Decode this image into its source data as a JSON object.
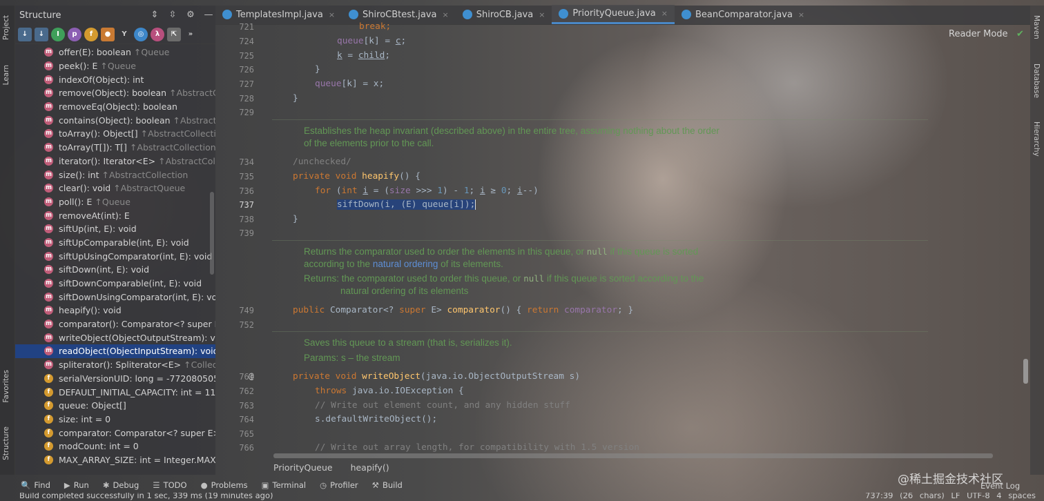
{
  "structure_panel": {
    "title": "Structure",
    "items": [
      {
        "label": "offer(E): boolean",
        "origin": "↑Queue",
        "kind": "method"
      },
      {
        "label": "peek(): E",
        "origin": "↑Queue",
        "kind": "method"
      },
      {
        "label": "indexOf(Object): int",
        "origin": "",
        "kind": "method"
      },
      {
        "label": "remove(Object): boolean",
        "origin": "↑AbstractCo",
        "kind": "method"
      },
      {
        "label": "removeEq(Object): boolean",
        "origin": "",
        "kind": "method"
      },
      {
        "label": "contains(Object): boolean",
        "origin": "↑AbstractC",
        "kind": "method"
      },
      {
        "label": "toArray(): Object[]",
        "origin": "↑AbstractCollection",
        "kind": "method"
      },
      {
        "label": "toArray(T[]): T[]",
        "origin": "↑AbstractCollection",
        "kind": "method"
      },
      {
        "label": "iterator(): Iterator<E>",
        "origin": "↑AbstractColle",
        "kind": "method"
      },
      {
        "label": "size(): int",
        "origin": "↑AbstractCollection",
        "kind": "method"
      },
      {
        "label": "clear(): void",
        "origin": "↑AbstractQueue",
        "kind": "method"
      },
      {
        "label": "poll(): E",
        "origin": "↑Queue",
        "kind": "method"
      },
      {
        "label": "removeAt(int): E",
        "origin": "",
        "kind": "method"
      },
      {
        "label": "siftUp(int, E): void",
        "origin": "",
        "kind": "method"
      },
      {
        "label": "siftUpComparable(int, E): void",
        "origin": "",
        "kind": "method"
      },
      {
        "label": "siftUpUsingComparator(int, E): void",
        "origin": "",
        "kind": "method"
      },
      {
        "label": "siftDown(int, E): void",
        "origin": "",
        "kind": "method"
      },
      {
        "label": "siftDownComparable(int, E): void",
        "origin": "",
        "kind": "method"
      },
      {
        "label": "siftDownUsingComparator(int, E): void",
        "origin": "",
        "kind": "method"
      },
      {
        "label": "heapify(): void",
        "origin": "",
        "kind": "method"
      },
      {
        "label": "comparator(): Comparator<? super E>",
        "origin": "",
        "kind": "method"
      },
      {
        "label": "writeObject(ObjectOutputStream): vo",
        "origin": "",
        "kind": "method"
      },
      {
        "label": "readObject(ObjectInputStream): void",
        "origin": "",
        "kind": "method"
      },
      {
        "label": "spliterator(): Spliterator<E>",
        "origin": "↑Collec",
        "kind": "method"
      },
      {
        "label": "serialVersionUID: long = -7720805057",
        "origin": "",
        "kind": "field"
      },
      {
        "label": "DEFAULT_INITIAL_CAPACITY: int = 11",
        "origin": "",
        "kind": "field"
      },
      {
        "label": "queue: Object[]",
        "origin": "",
        "kind": "field"
      },
      {
        "label": "size: int = 0",
        "origin": "",
        "kind": "field"
      },
      {
        "label": "comparator: Comparator<? super E>",
        "origin": "",
        "kind": "field"
      },
      {
        "label": "modCount: int = 0",
        "origin": "",
        "kind": "field"
      },
      {
        "label": "MAX_ARRAY_SIZE: int = Integer.MAX",
        "origin": "",
        "kind": "field"
      }
    ],
    "selected_index": 22
  },
  "left_tool_tabs": {
    "project": "Project",
    "learn": "Learn",
    "favorites": "Favorites",
    "structure": "Structure"
  },
  "right_tool_tabs": {
    "maven": "Maven",
    "database": "Database",
    "hierarchy": "Hierarchy"
  },
  "editor_tabs": [
    {
      "label": "TemplatesImpl.java",
      "active": false
    },
    {
      "label": "ShiroCBtest.java",
      "active": false
    },
    {
      "label": "ShiroCB.java",
      "active": false
    },
    {
      "label": "PriorityQueue.java",
      "active": true
    },
    {
      "label": "BeanComparator.java",
      "active": false
    }
  ],
  "reader_mode": "Reader Mode",
  "line_numbers": {
    "l721": "721",
    "l724": "724",
    "l725": "725",
    "l726": "726",
    "l727": "727",
    "l728": "728",
    "l729": "729",
    "l734": "734",
    "l735": "735",
    "l736": "736",
    "l737": "737",
    "l738": "738",
    "l739": "739",
    "l749": "749",
    "l752": "752",
    "l761": "761",
    "l762": "762",
    "l763": "763",
    "l764": "764",
    "l765": "765",
    "l766": "766"
  },
  "code": {
    "c_break": "break;",
    "c_queuek1": "queue",
    "c_queuek2": "[k] = ",
    "c_queuek3": "c",
    "c_k1": "k",
    "c_k2": " = ",
    "c_k3": "child",
    "c_rbrace1": "}",
    "c_qx1": "queue",
    "c_qx2": "[k] = x;",
    "c_rbrace2": "}",
    "doc_heapify_1": "Establishes the heap invariant (described above) in the entire tree, assuming nothing about the order",
    "doc_heapify_2": "of the elements prior to the call.",
    "c_unchecked": "/unchecked/",
    "c_heapify_kw": "private void ",
    "c_heapify_fn": "heapify",
    "c_heapify_rest": "() {",
    "c_for_kw": "for ",
    "c_for_rest1": "(",
    "c_for_int": "int ",
    "c_for_i": "i",
    "c_for_eq": " = (",
    "c_for_size": "size",
    "c_for_shift": " >>> ",
    "c_for_one": "1",
    "c_for_minus": ") - ",
    "c_for_one2": "1",
    "c_for_semi": "; ",
    "c_for_i2": "i",
    "c_for_ge": " ≥ ",
    "c_for_zero": "0",
    "c_for_semi2": "; ",
    "c_for_i3": "i",
    "c_for_end": "--)",
    "c_sift": "siftDown(i, (E) queue[i]);",
    "c_rbrace3": "}",
    "doc_comp_1a": "Returns the comparator used to order the elements in this queue, or ",
    "doc_comp_1b": "null",
    "doc_comp_1c": " if this queue is sorted",
    "doc_comp_2a": "according to the ",
    "doc_comp_2b": "natural ordering",
    "doc_comp_2c": " of its elements.",
    "doc_comp_3a": "Returns: the comparator used to order this queue, or ",
    "doc_comp_3b": "null",
    "doc_comp_3c": " if this queue is sorted according to the",
    "doc_comp_4": "natural ordering of its elements",
    "c_comp_kw": "public ",
    "c_comp_type": "Comparator<? ",
    "c_comp_super": "super ",
    "c_comp_e": "E> ",
    "c_comp_fn": "comparator",
    "c_comp_mid": "() { ",
    "c_comp_ret": "return ",
    "c_comp_fld": "comparator",
    "c_comp_end": "; }",
    "doc_write_1": "Saves this queue to a stream (that is, serializes it).",
    "doc_write_2": "Params: s – the stream",
    "c_write_kw": "private void ",
    "c_write_fn": "writeObject",
    "c_write_rest": "(java.io.ObjectOutputStream s)",
    "c_throws_kw": "throws ",
    "c_throws_rest": "java.io.IOException {",
    "c_cm1": "// Write out element count, and any hidden stuff",
    "c_default": "s.defaultWriteObject();",
    "c_cm2": "// Write out array length, for compatibility with 1.5 version",
    "gutter_at": "@"
  },
  "breadcrumb": [
    "PriorityQueue",
    "heapify()"
  ],
  "tool_windows": [
    {
      "icon": "search-icon",
      "glyph": "🔍",
      "label": "Find"
    },
    {
      "icon": "run-icon",
      "glyph": "▶",
      "label": "Run"
    },
    {
      "icon": "debug-icon",
      "glyph": "✱",
      "label": "Debug"
    },
    {
      "icon": "todo-icon",
      "glyph": "☰",
      "label": "TODO"
    },
    {
      "icon": "problems-icon",
      "glyph": "●",
      "label": "Problems"
    },
    {
      "icon": "terminal-icon",
      "glyph": "▣",
      "label": "Terminal"
    },
    {
      "icon": "profiler-icon",
      "glyph": "◷",
      "label": "Profiler"
    },
    {
      "icon": "build-icon",
      "glyph": "⚒",
      "label": "Build"
    }
  ],
  "event_log": "Event Log",
  "watermark": "@稀土掘金技术社区",
  "status": {
    "message": "Build completed successfully in 1 sec, 339 ms (19 minutes ago)",
    "position": "737:39 (26 chars)",
    "line_sep": "LF",
    "encoding": "UTF-8",
    "indent": "4 spaces"
  }
}
